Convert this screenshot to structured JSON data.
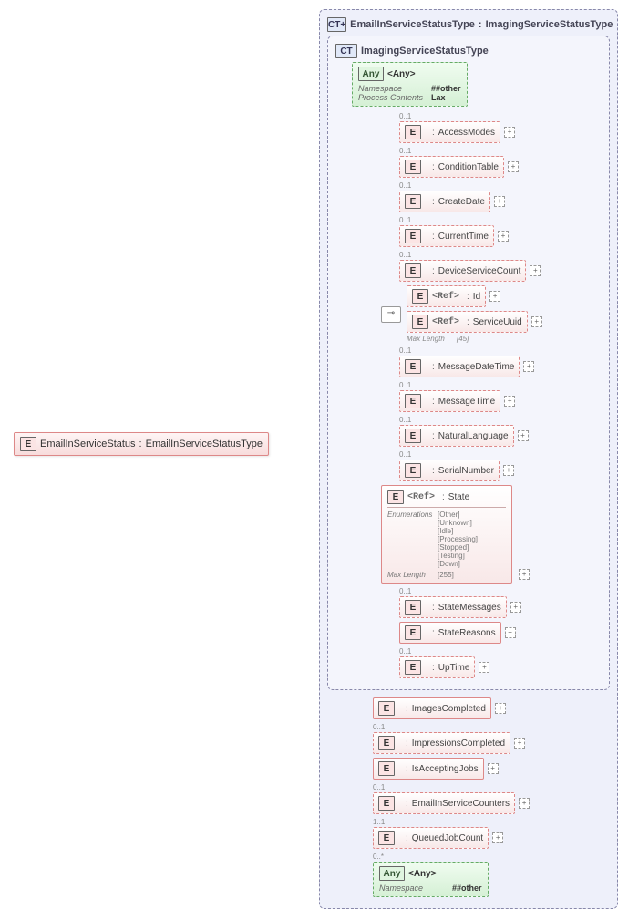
{
  "root": {
    "badge": "E",
    "name": "EmailInServiceStatus",
    "type": "EmailInServiceStatusType"
  },
  "outerCT": {
    "badge": "CT",
    "name": "EmailInServiceStatusType",
    "ext": "ImagingServiceStatusType"
  },
  "innerCT": {
    "badge": "CT",
    "name": "ImagingServiceStatusType"
  },
  "any1": {
    "badge": "Any",
    "label": "<Any>",
    "rows": [
      {
        "k": "Namespace",
        "v": "##other"
      },
      {
        "k": "Process Contents",
        "v": "Lax"
      }
    ]
  },
  "refLabel": "<Ref>",
  "innerItems": [
    {
      "card": "0..1",
      "type": "AccessModes"
    },
    {
      "card": "0..1",
      "type": "ConditionTable"
    },
    {
      "card": "0..1",
      "type": "CreateDate"
    },
    {
      "card": "0..1",
      "type": "CurrentTime"
    },
    {
      "card": "0..1",
      "type": "DeviceServiceCount"
    }
  ],
  "choice": {
    "id": {
      "type": "Id"
    },
    "uuid": {
      "type": "ServiceUuid",
      "maxLenLabel": "Max Length",
      "maxLen": "[45]"
    }
  },
  "innerItems2": [
    {
      "card": "0..1",
      "type": "MessageDateTime"
    },
    {
      "card": "0..1",
      "type": "MessageTime"
    },
    {
      "card": "0..1",
      "type": "NaturalLanguage"
    },
    {
      "card": "0..1",
      "type": "SerialNumber"
    }
  ],
  "state": {
    "type": "State",
    "enumLabel": "Enumerations",
    "enums": [
      "[Other]",
      "[Unknown]",
      "[Idle]",
      "[Processing]",
      "[Stopped]",
      "[Testing]",
      "[Down]"
    ],
    "maxLenLabel": "Max Length",
    "maxLen": "[255]"
  },
  "innerItems3": [
    {
      "card": "0..1",
      "type": "StateMessages"
    },
    {
      "card": "",
      "type": "StateReasons",
      "solid": true
    },
    {
      "card": "0..1",
      "type": "UpTime"
    }
  ],
  "outerItems": [
    {
      "card": "",
      "type": "ImagesCompleted",
      "solid": true
    },
    {
      "card": "0..1",
      "type": "ImpressionsCompleted"
    },
    {
      "card": "",
      "type": "IsAcceptingJobs",
      "solid": true
    },
    {
      "card": "0..1",
      "type": "EmailInServiceCounters"
    },
    {
      "card": "1..1",
      "type": "QueuedJobCount"
    }
  ],
  "any2": {
    "card": "0..*",
    "badge": "Any",
    "label": "<Any>",
    "rows": [
      {
        "k": "Namespace",
        "v": "##other"
      }
    ]
  },
  "colon": ":",
  "plus": "+"
}
